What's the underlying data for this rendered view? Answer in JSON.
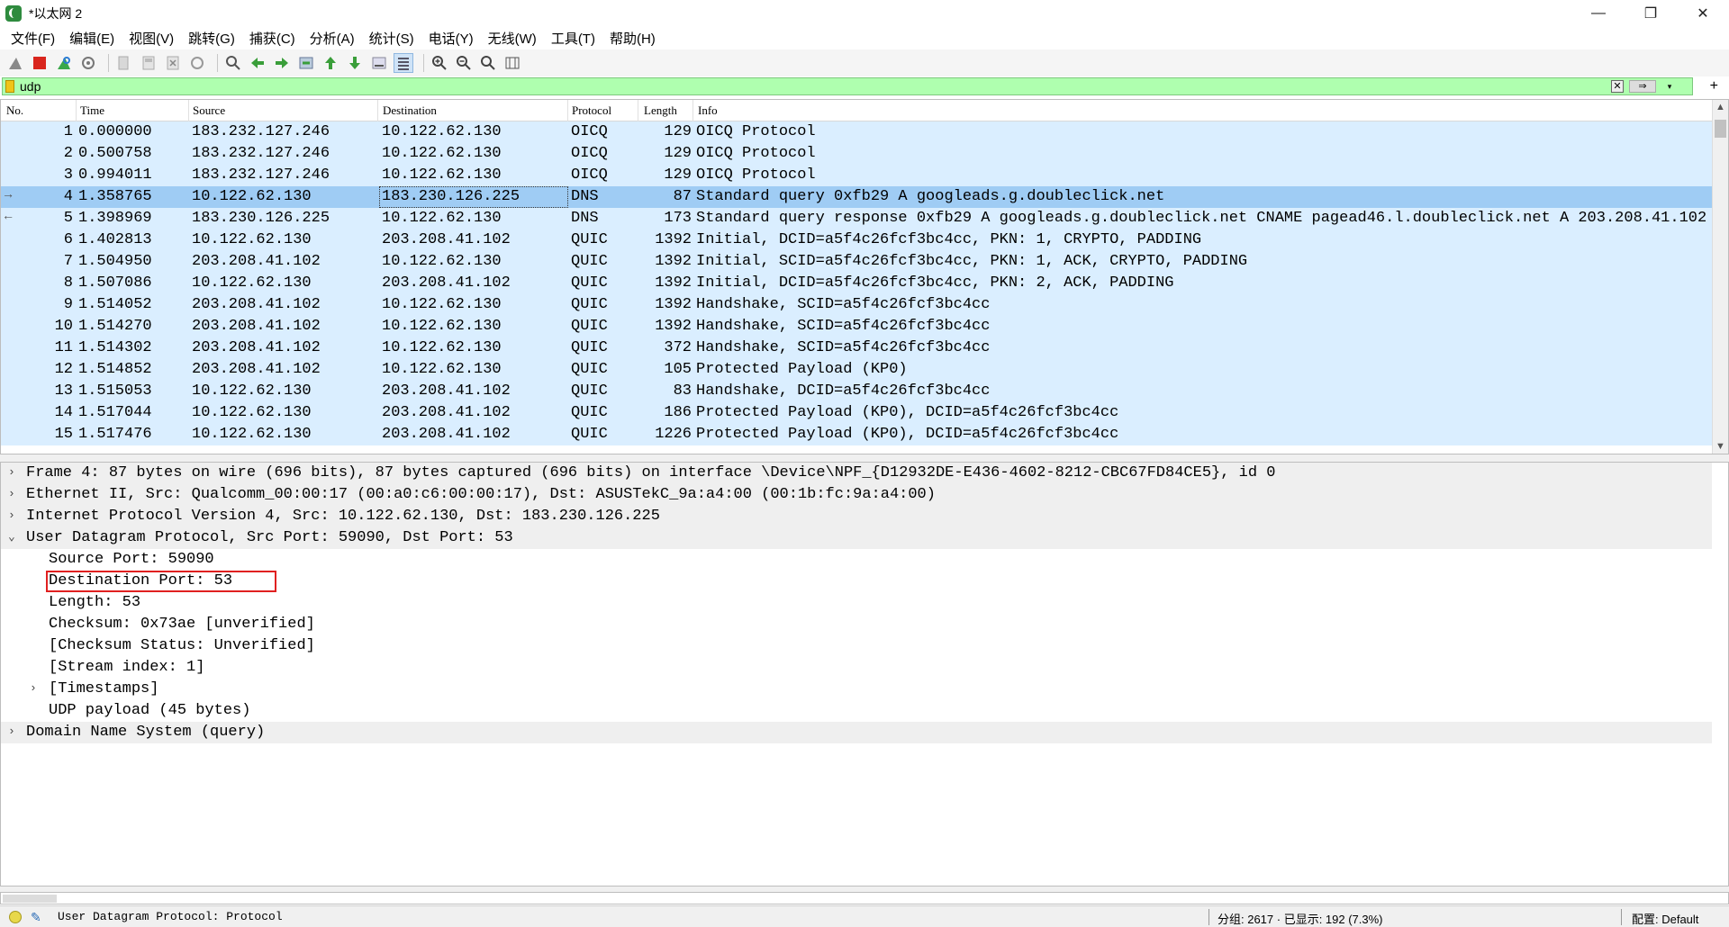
{
  "window": {
    "title": "*以太网 2",
    "minimize": "—",
    "maximize": "❐",
    "close": "✕"
  },
  "menu": [
    "文件(F)",
    "编辑(E)",
    "视图(V)",
    "跳转(G)",
    "捕获(C)",
    "分析(A)",
    "统计(S)",
    "电话(Y)",
    "无线(W)",
    "工具(T)",
    "帮助(H)"
  ],
  "toolbar": {
    "icons": [
      "shark-fin-start-icon",
      "stop-capture-icon",
      "restart-capture-icon",
      "capture-options-icon",
      "open-file-icon",
      "save-file-icon",
      "close-file-icon",
      "reload-file-icon",
      "find-packet-icon",
      "go-back-icon",
      "go-forward-icon",
      "go-to-packet-icon",
      "go-first-icon",
      "go-last-icon",
      "auto-scroll-icon",
      "colorize-icon",
      "zoom-in-icon",
      "zoom-out-icon",
      "zoom-normal-icon",
      "resize-columns-icon"
    ]
  },
  "filter": {
    "value": "udp",
    "clear_icon": "✕",
    "apply_icon": "⇒",
    "dropdown_icon": "▾",
    "add_icon": "+"
  },
  "packet_list": {
    "columns": [
      "No.",
      "Time",
      "Source",
      "Destination",
      "Protocol",
      "Length",
      "Info"
    ],
    "rows": [
      {
        "no": "1",
        "time": "0.000000",
        "src": "183.232.127.246",
        "dst": "10.122.62.130",
        "proto": "OICQ",
        "len": "129",
        "info": "OICQ Protocol"
      },
      {
        "no": "2",
        "time": "0.500758",
        "src": "183.232.127.246",
        "dst": "10.122.62.130",
        "proto": "OICQ",
        "len": "129",
        "info": "OICQ Protocol"
      },
      {
        "no": "3",
        "time": "0.994011",
        "src": "183.232.127.246",
        "dst": "10.122.62.130",
        "proto": "OICQ",
        "len": "129",
        "info": "OICQ Protocol"
      },
      {
        "no": "4",
        "time": "1.358765",
        "src": "10.122.62.130",
        "dst": "183.230.126.225",
        "proto": "DNS",
        "len": "87",
        "info": "Standard query 0xfb29 A googleads.g.doubleclick.net"
      },
      {
        "no": "5",
        "time": "1.398969",
        "src": "183.230.126.225",
        "dst": "10.122.62.130",
        "proto": "DNS",
        "len": "173",
        "info": "Standard query response 0xfb29 A googleads.g.doubleclick.net CNAME pagead46.l.doubleclick.net A 203.208.41.102"
      },
      {
        "no": "6",
        "time": "1.402813",
        "src": "10.122.62.130",
        "dst": "203.208.41.102",
        "proto": "QUIC",
        "len": "1392",
        "info": "Initial, DCID=a5f4c26fcf3bc4cc, PKN: 1, CRYPTO, PADDING"
      },
      {
        "no": "7",
        "time": "1.504950",
        "src": "203.208.41.102",
        "dst": "10.122.62.130",
        "proto": "QUIC",
        "len": "1392",
        "info": "Initial, SCID=a5f4c26fcf3bc4cc, PKN: 1, ACK, CRYPTO, PADDING"
      },
      {
        "no": "8",
        "time": "1.507086",
        "src": "10.122.62.130",
        "dst": "203.208.41.102",
        "proto": "QUIC",
        "len": "1392",
        "info": "Initial, DCID=a5f4c26fcf3bc4cc, PKN: 2, ACK, PADDING"
      },
      {
        "no": "9",
        "time": "1.514052",
        "src": "203.208.41.102",
        "dst": "10.122.62.130",
        "proto": "QUIC",
        "len": "1392",
        "info": "Handshake, SCID=a5f4c26fcf3bc4cc"
      },
      {
        "no": "10",
        "time": "1.514270",
        "src": "203.208.41.102",
        "dst": "10.122.62.130",
        "proto": "QUIC",
        "len": "1392",
        "info": "Handshake, SCID=a5f4c26fcf3bc4cc"
      },
      {
        "no": "11",
        "time": "1.514302",
        "src": "203.208.41.102",
        "dst": "10.122.62.130",
        "proto": "QUIC",
        "len": "372",
        "info": "Handshake, SCID=a5f4c26fcf3bc4cc"
      },
      {
        "no": "12",
        "time": "1.514852",
        "src": "203.208.41.102",
        "dst": "10.122.62.130",
        "proto": "QUIC",
        "len": "105",
        "info": "Protected Payload (KP0)"
      },
      {
        "no": "13",
        "time": "1.515053",
        "src": "10.122.62.130",
        "dst": "203.208.41.102",
        "proto": "QUIC",
        "len": "83",
        "info": "Handshake, DCID=a5f4c26fcf3bc4cc"
      },
      {
        "no": "14",
        "time": "1.517044",
        "src": "10.122.62.130",
        "dst": "203.208.41.102",
        "proto": "QUIC",
        "len": "186",
        "info": "Protected Payload (KP0), DCID=a5f4c26fcf3bc4cc"
      },
      {
        "no": "15",
        "time": "1.517476",
        "src": "10.122.62.130",
        "dst": "203.208.41.102",
        "proto": "QUIC",
        "len": "1226",
        "info": "Protected Payload (KP0), DCID=a5f4c26fcf3bc4cc"
      }
    ],
    "selected_index": 3
  },
  "details": {
    "rows": [
      {
        "level": 0,
        "arrow": "›",
        "text": "Frame 4: 87 bytes on wire (696 bits), 87 bytes captured (696 bits) on interface \\Device\\NPF_{D12932DE-E436-4602-8212-CBC67FD84CE5}, id 0"
      },
      {
        "level": 0,
        "arrow": "›",
        "text": "Ethernet II, Src: Qualcomm_00:00:17 (00:a0:c6:00:00:17), Dst: ASUSTekC_9a:a4:00 (00:1b:fc:9a:a4:00)"
      },
      {
        "level": 0,
        "arrow": "›",
        "text": "Internet Protocol Version 4, Src: 10.122.62.130, Dst: 183.230.126.225"
      },
      {
        "level": 0,
        "arrow": "⌄",
        "text": "User Datagram Protocol, Src Port: 59090, Dst Port: 53"
      },
      {
        "level": 1,
        "arrow": "",
        "text": "Source Port: 59090"
      },
      {
        "level": 1,
        "arrow": "",
        "text": "Destination Port: 53",
        "highlight": true
      },
      {
        "level": 1,
        "arrow": "",
        "text": "Length: 53"
      },
      {
        "level": 1,
        "arrow": "",
        "text": "Checksum: 0x73ae [unverified]"
      },
      {
        "level": 1,
        "arrow": "",
        "text": "[Checksum Status: Unverified]"
      },
      {
        "level": 1,
        "arrow": "",
        "text": "[Stream index: 1]"
      },
      {
        "level": 1,
        "arrow": "›",
        "text": "[Timestamps]"
      },
      {
        "level": 1,
        "arrow": "",
        "text": "UDP payload (45 bytes)"
      },
      {
        "level": 0,
        "arrow": "›",
        "text": "Domain Name System (query)"
      }
    ]
  },
  "status": {
    "field_text": "User Datagram Protocol: Protocol",
    "packets_text": "分组: 2617 · 已显示: 192 (7.3%)",
    "profile_text": "配置: Default"
  },
  "colors": {
    "row_bg": "#daeeff",
    "row_selected": "#9fccf4",
    "filter_bg": "#afffaf",
    "highlight_border": "#e02020"
  }
}
